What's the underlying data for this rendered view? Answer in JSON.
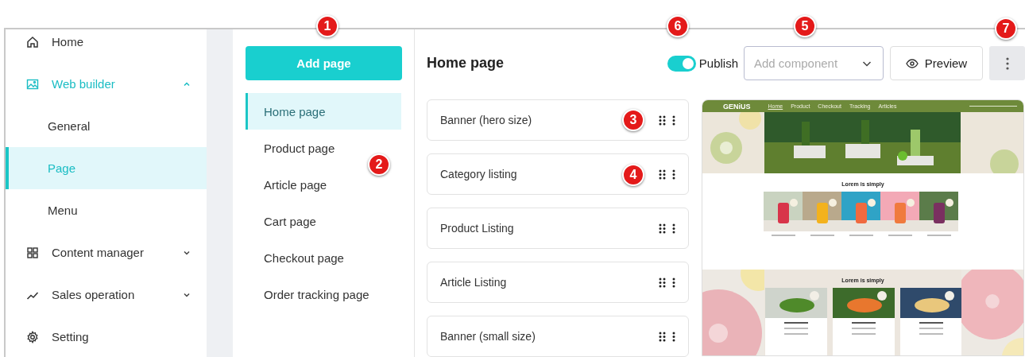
{
  "sidebar": {
    "items": [
      {
        "label": "Home"
      },
      {
        "label": "Web builder",
        "expanded": true,
        "children": [
          {
            "label": "General",
            "selected": false
          },
          {
            "label": "Page",
            "selected": true
          },
          {
            "label": "Menu",
            "selected": false
          }
        ]
      },
      {
        "label": "Content manager",
        "expanded": false
      },
      {
        "label": "Sales operation",
        "expanded": false
      },
      {
        "label": "Setting"
      }
    ]
  },
  "page_list": {
    "add_button": "Add page",
    "items": [
      {
        "label": "Home page",
        "selected": true
      },
      {
        "label": "Product page",
        "selected": false
      },
      {
        "label": "Article page",
        "selected": false
      },
      {
        "label": "Cart page",
        "selected": false
      },
      {
        "label": "Checkout page",
        "selected": false
      },
      {
        "label": "Order tracking page",
        "selected": false
      }
    ]
  },
  "editor": {
    "title": "Home page",
    "publish": {
      "label": "Publish",
      "on": true
    },
    "component_select": {
      "placeholder": "Add component"
    },
    "preview_button": "Preview",
    "components": [
      {
        "label": "Banner (hero size)"
      },
      {
        "label": "Category listing"
      },
      {
        "label": "Product Listing"
      },
      {
        "label": "Article Listing"
      },
      {
        "label": "Banner (small size)"
      }
    ]
  },
  "preview": {
    "logo": "GENiUS",
    "nav": [
      {
        "label": "Home",
        "selected": true
      },
      {
        "label": "Product",
        "selected": false
      },
      {
        "label": "Checkout",
        "selected": false
      },
      {
        "label": "Tracking",
        "selected": false
      },
      {
        "label": "Articles",
        "selected": false
      }
    ],
    "sections": [
      {
        "title": "Lorem is simply"
      },
      {
        "title": "Lorem is simply"
      }
    ]
  },
  "callouts": [
    {
      "label": "1"
    },
    {
      "label": "6"
    },
    {
      "label": "5"
    },
    {
      "label": "7"
    },
    {
      "label": "3"
    },
    {
      "label": "2"
    },
    {
      "label": "4"
    }
  ]
}
